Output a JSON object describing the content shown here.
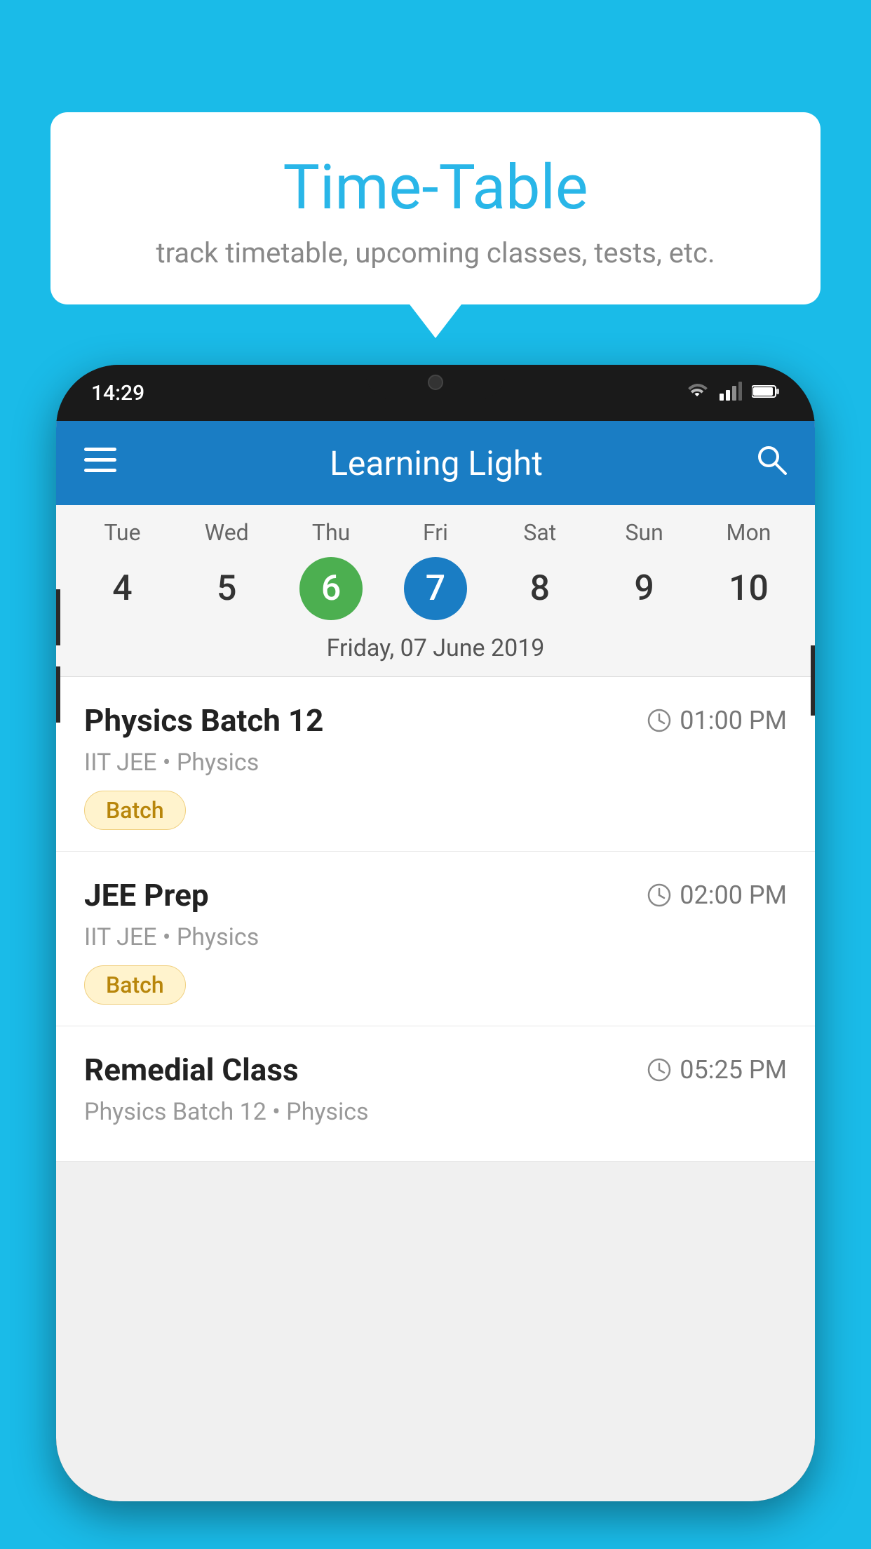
{
  "background_color": "#1ABBE8",
  "bubble": {
    "title": "Time-Table",
    "subtitle": "track timetable, upcoming classes, tests, etc."
  },
  "phone": {
    "status_bar": {
      "time": "14:29"
    },
    "toolbar": {
      "title": "Learning Light"
    },
    "calendar": {
      "days": [
        {
          "name": "Tue",
          "num": "4",
          "state": "normal"
        },
        {
          "name": "Wed",
          "num": "5",
          "state": "normal"
        },
        {
          "name": "Thu",
          "num": "6",
          "state": "today"
        },
        {
          "name": "Fri",
          "num": "7",
          "state": "selected"
        },
        {
          "name": "Sat",
          "num": "8",
          "state": "normal"
        },
        {
          "name": "Sun",
          "num": "9",
          "state": "normal"
        },
        {
          "name": "Mon",
          "num": "10",
          "state": "normal"
        }
      ],
      "selected_date": "Friday, 07 June 2019"
    },
    "schedule": [
      {
        "title": "Physics Batch 12",
        "time": "01:00 PM",
        "subtitle": "IIT JEE • Physics",
        "badge": "Batch"
      },
      {
        "title": "JEE Prep",
        "time": "02:00 PM",
        "subtitle": "IIT JEE • Physics",
        "badge": "Batch"
      },
      {
        "title": "Remedial Class",
        "time": "05:25 PM",
        "subtitle": "Physics Batch 12 • Physics",
        "badge": ""
      }
    ]
  }
}
